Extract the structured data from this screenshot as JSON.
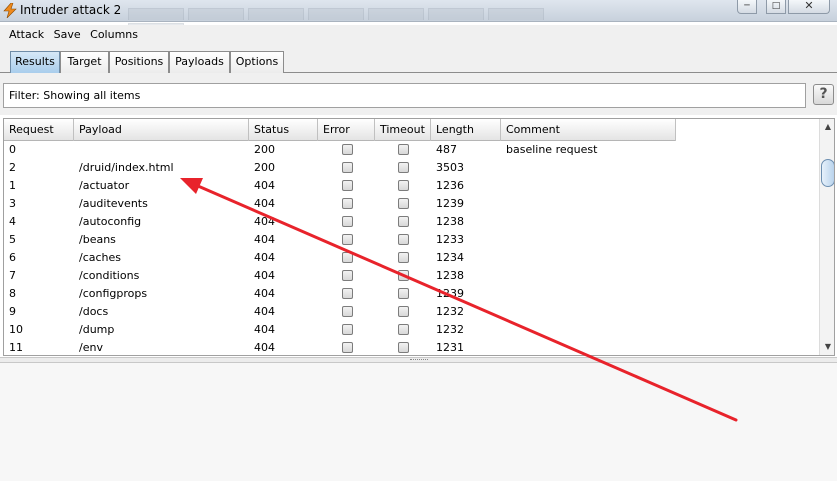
{
  "window": {
    "title": "Intruder attack 2"
  },
  "menu": [
    "Attack",
    "Save",
    "Columns"
  ],
  "tabs": [
    {
      "label": "Results",
      "active": true
    },
    {
      "label": "Target",
      "active": false
    },
    {
      "label": "Positions",
      "active": false
    },
    {
      "label": "Payloads",
      "active": false
    },
    {
      "label": "Options",
      "active": false
    }
  ],
  "filter": {
    "text": "Filter:  Showing all items",
    "help_label": "?"
  },
  "table": {
    "columns": [
      "Request",
      "Payload",
      "Status",
      "Error",
      "Timeout",
      "Length",
      "Comment"
    ],
    "rows": [
      {
        "request": "0",
        "payload": "",
        "status": "200",
        "length": "487",
        "comment": "baseline request"
      },
      {
        "request": "2",
        "payload": "/druid/index.html",
        "status": "200",
        "length": "3503",
        "comment": ""
      },
      {
        "request": "1",
        "payload": "/actuator",
        "status": "404",
        "length": "1236",
        "comment": ""
      },
      {
        "request": "3",
        "payload": "/auditevents",
        "status": "404",
        "length": "1239",
        "comment": ""
      },
      {
        "request": "4",
        "payload": "/autoconfig",
        "status": "404",
        "length": "1238",
        "comment": ""
      },
      {
        "request": "5",
        "payload": "/beans",
        "status": "404",
        "length": "1233",
        "comment": ""
      },
      {
        "request": "6",
        "payload": "/caches",
        "status": "404",
        "length": "1234",
        "comment": ""
      },
      {
        "request": "7",
        "payload": "/conditions",
        "status": "404",
        "length": "1238",
        "comment": ""
      },
      {
        "request": "8",
        "payload": "/configprops",
        "status": "404",
        "length": "1239",
        "comment": ""
      },
      {
        "request": "9",
        "payload": "/docs",
        "status": "404",
        "length": "1232",
        "comment": ""
      },
      {
        "request": "10",
        "payload": "/dump",
        "status": "404",
        "length": "1232",
        "comment": ""
      },
      {
        "request": "11",
        "payload": "/env",
        "status": "404",
        "length": "1231",
        "comment": ""
      }
    ]
  },
  "colors": {
    "annotation_arrow": "#e8232b",
    "active_tab": "#a9cdec",
    "app_icon": "#f08a1c"
  },
  "icons": {
    "app": "burp-lightning-icon",
    "minimize": "minimize-icon",
    "maximize": "maximize-icon",
    "close": "close-icon"
  }
}
